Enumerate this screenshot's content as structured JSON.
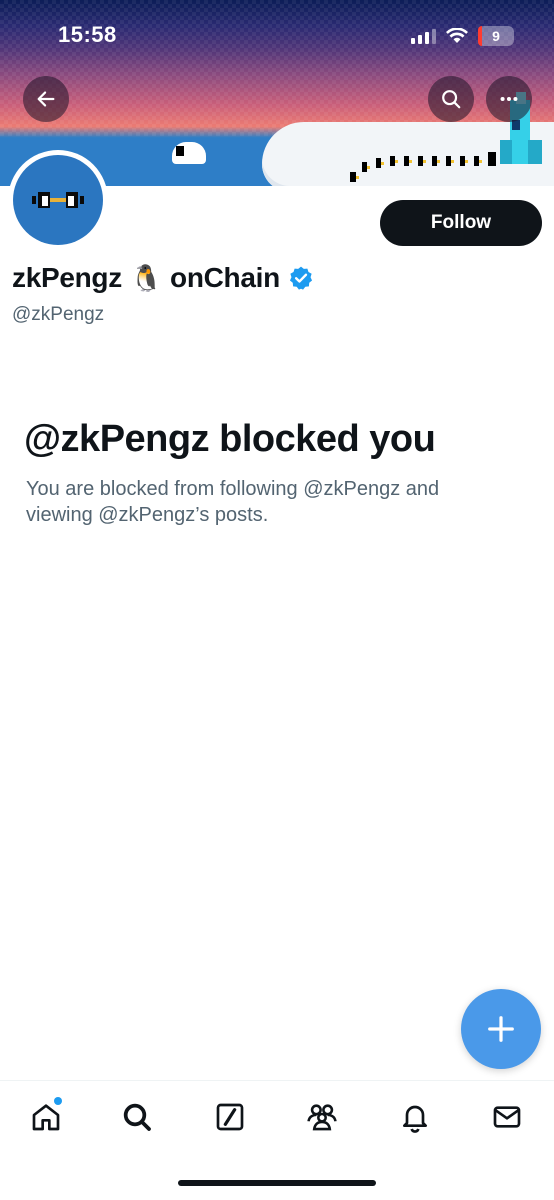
{
  "status_bar": {
    "time": "15:58",
    "battery": "9"
  },
  "header": {
    "back_icon": "arrow-left-icon",
    "search_icon": "search-icon",
    "more_icon": "more-horizontal-icon"
  },
  "profile": {
    "display_name": "zkPengz",
    "emoji": "🐧",
    "display_name_suffix": "onChain",
    "verified": true,
    "handle": "@zkPengz",
    "follow_label": "Follow"
  },
  "blocked": {
    "title": "@zkPengz blocked you",
    "message": "You are blocked from following @zkPengz and viewing @zkPengz’s posts."
  },
  "fab": {
    "icon": "plus-icon"
  },
  "tabbar": {
    "items": [
      {
        "icon": "home-icon",
        "has_badge": true
      },
      {
        "icon": "search-icon"
      },
      {
        "icon": "grok-icon"
      },
      {
        "icon": "communities-icon"
      },
      {
        "icon": "bell-icon"
      },
      {
        "icon": "mail-icon"
      }
    ]
  },
  "colors": {
    "accent": "#1d9bf0",
    "fab": "#4a99e9",
    "follow_button": "#0f1419",
    "secondary_text": "#536471"
  }
}
